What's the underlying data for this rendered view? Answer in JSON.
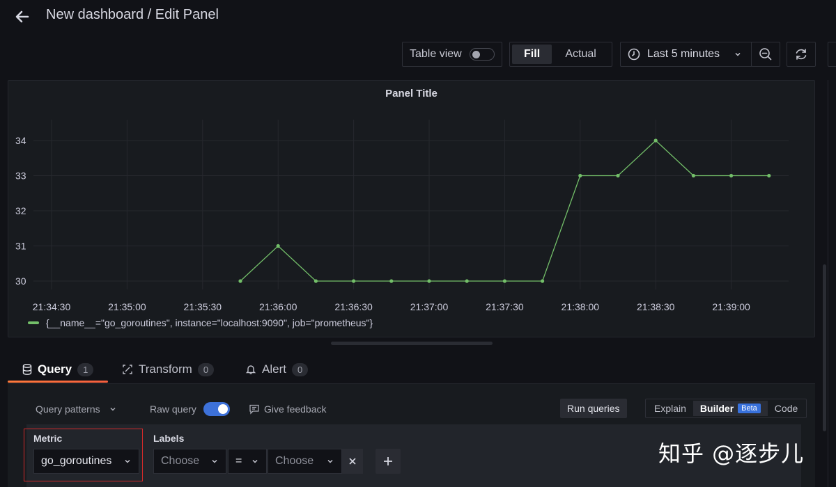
{
  "header": {
    "title": "New dashboard / Edit Panel"
  },
  "toolbar": {
    "table_view_label": "Table view",
    "table_view_on": false,
    "fill_label": "Fill",
    "actual_label": "Actual",
    "time_range": "Last 5 minutes"
  },
  "panel": {
    "title": "Panel Title",
    "legend": "{__name__=\"go_goroutines\", instance=\"localhost:9090\", job=\"prometheus\"}"
  },
  "chart_data": {
    "type": "line",
    "title": "Panel Title",
    "y_ticks": [
      "30",
      "31",
      "32",
      "33",
      "34"
    ],
    "ylim": [
      30,
      34
    ],
    "x_ticks": [
      "21:34:30",
      "21:35:00",
      "21:35:30",
      "21:36:00",
      "21:36:30",
      "21:37:00",
      "21:37:30",
      "21:38:00",
      "21:38:30",
      "21:39:00"
    ],
    "x_tick_seconds": [
      0,
      30,
      60,
      90,
      120,
      150,
      180,
      210,
      240,
      270
    ],
    "grid": true,
    "legend_position": "bottom-left",
    "series": [
      {
        "name": "{__name__=\"go_goroutines\", instance=\"localhost:9090\", job=\"prometheus\"}",
        "color": "#73bf69",
        "x": [
          "21:35:45",
          "21:36:00",
          "21:36:15",
          "21:36:30",
          "21:36:45",
          "21:37:00",
          "21:37:15",
          "21:37:30",
          "21:37:45",
          "21:38:00",
          "21:38:15",
          "21:38:30",
          "21:38:45",
          "21:39:00",
          "21:39:15"
        ],
        "values": [
          30,
          31,
          30,
          30,
          30,
          30,
          30,
          30,
          30,
          33,
          33,
          34,
          33,
          33,
          33
        ]
      }
    ]
  },
  "tabs": [
    {
      "label": "Query",
      "count": "1"
    },
    {
      "label": "Transform",
      "count": "0"
    },
    {
      "label": "Alert",
      "count": "0"
    }
  ],
  "query_editor": {
    "query_patterns": "Query patterns",
    "raw_query": "Raw query",
    "raw_query_on": true,
    "give_feedback": "Give feedback",
    "run_queries": "Run queries",
    "modes": {
      "explain": "Explain",
      "builder": "Builder",
      "beta": "Beta",
      "code": "Code"
    },
    "metric_label": "Metric",
    "metric_value": "go_goroutines",
    "labels_label": "Labels",
    "label_key_placeholder": "Choose",
    "label_operator": "=",
    "label_value_placeholder": "Choose"
  },
  "watermark": "知乎 @逐步儿",
  "colors": {
    "series_green": "#73bf69",
    "raw_query_toggle": "#3d71d9",
    "tab_underline": "#ff7a3c",
    "metric_highlight_border": "#d42a2a"
  }
}
